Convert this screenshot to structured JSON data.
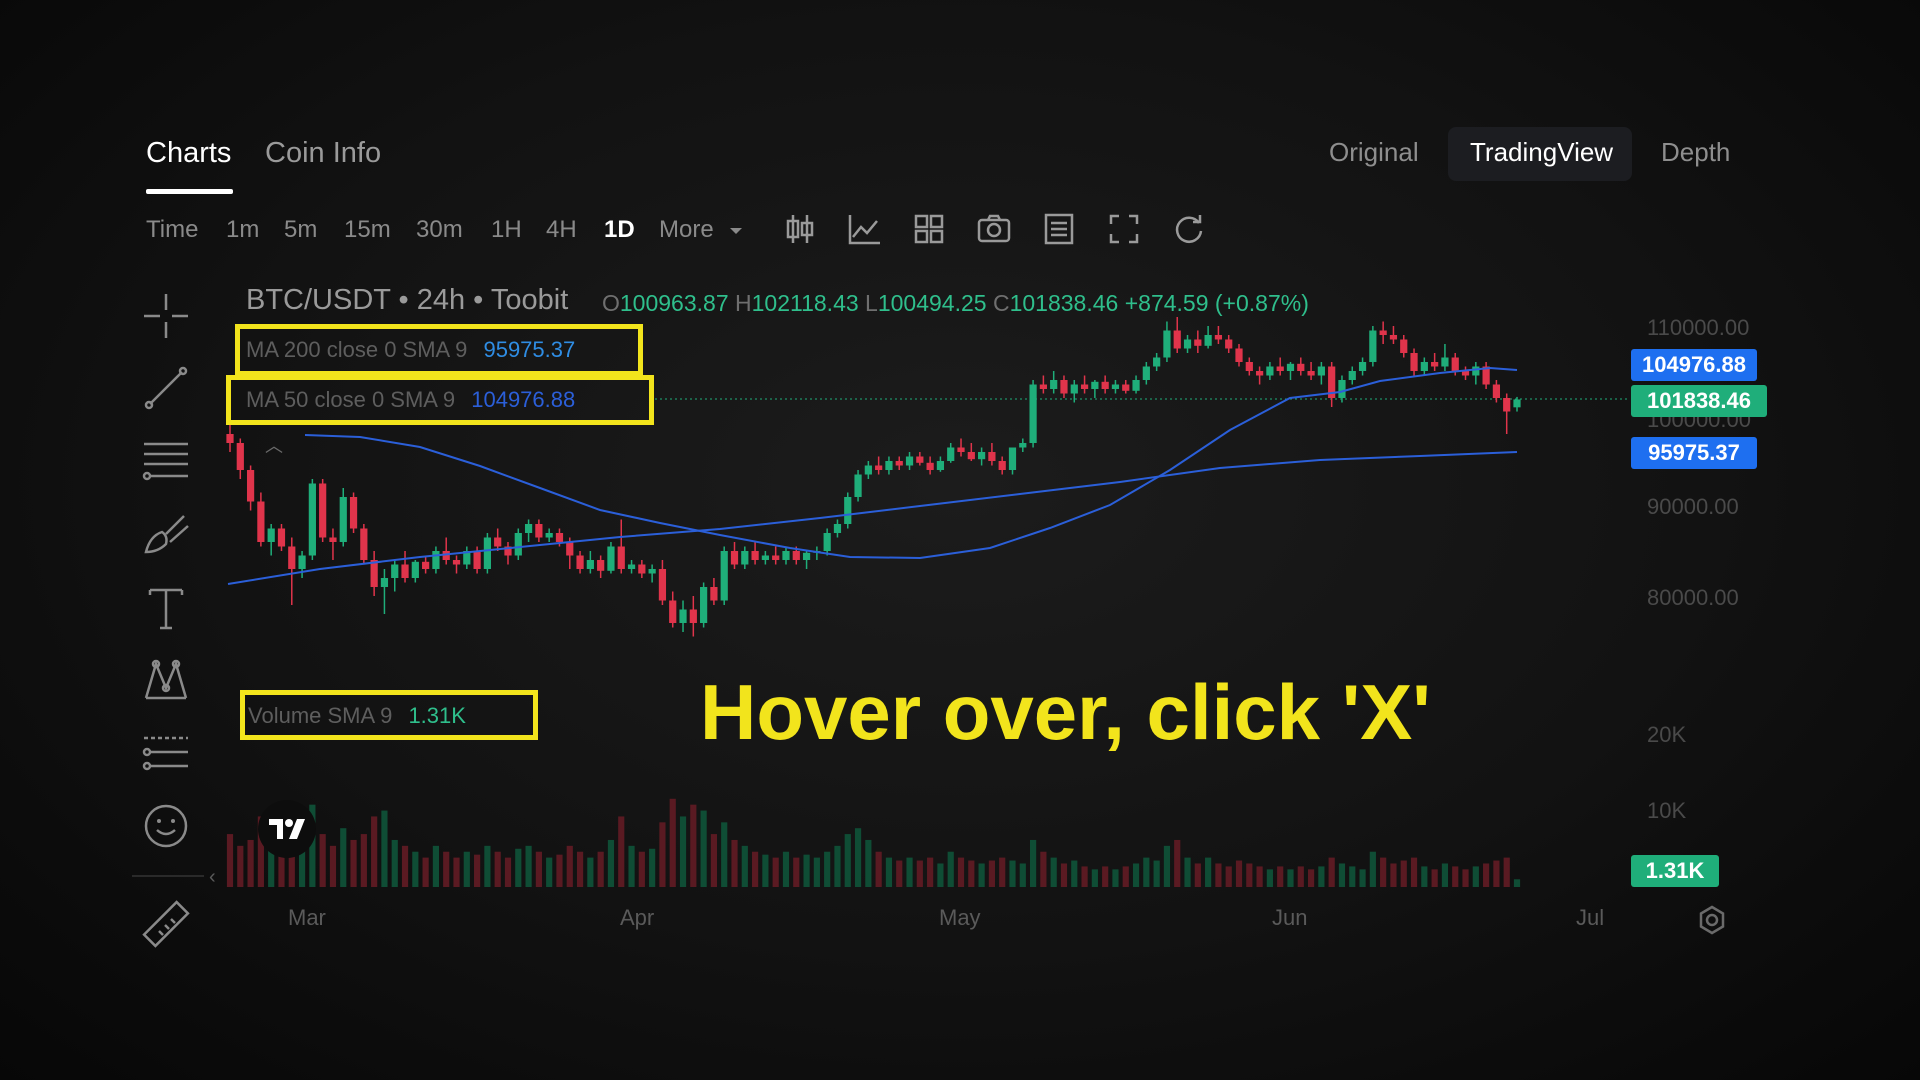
{
  "tabs": {
    "charts": "Charts",
    "coin_info": "Coin Info"
  },
  "views": {
    "original": "Original",
    "tradingview": "TradingView",
    "depth": "Depth",
    "selected": "TradingView"
  },
  "timeframes": [
    "Time",
    "1m",
    "5m",
    "15m",
    "30m",
    "1H",
    "4H",
    "1D",
    "More"
  ],
  "timeframe_selected": "1D",
  "toolbar_icons": [
    "candle-type-icon",
    "indicators-icon",
    "layout-grid-icon",
    "camera-icon",
    "list-icon",
    "fullscreen-icon",
    "reset-icon"
  ],
  "drawing_tools": [
    "crosshair-icon",
    "trendline-icon",
    "horizontal-lines-icon",
    "brush-icon",
    "text-icon",
    "pattern-icon",
    "measure-lines-icon",
    "emoji-icon",
    "ruler-icon"
  ],
  "chart_header": {
    "symbol": "BTC/USDT • 24h • Toobit",
    "o_label": "O",
    "o": "100963.87",
    "h_label": "H",
    "h": "102118.43",
    "l_label": "L",
    "l": "100494.25",
    "c_label": "C",
    "c": "101838.46",
    "change": "+874.59 (+0.87%)"
  },
  "legends": {
    "ma200_name": "MA 200 close 0 SMA 9",
    "ma200_value": "95975.37",
    "ma50_name": "MA 50 close 0 SMA 9",
    "ma50_value": "104976.88",
    "volume_name": "Volume SMA 9",
    "volume_value": "1.31K"
  },
  "price_tags": {
    "ma50": "104976.88",
    "last": "101838.46",
    "ma200": "95975.37",
    "volume": "1.31K"
  },
  "price_axis": [
    "110000.00",
    "100000.00",
    "90000.00",
    "80000.00"
  ],
  "volume_axis": [
    "20K",
    "10K"
  ],
  "months": [
    "Mar",
    "Apr",
    "May",
    "Jun",
    "Jul"
  ],
  "hint_text": "Hover over, click 'X'",
  "colors": {
    "up": "#1fae7a",
    "down": "#e0344b",
    "ma": "#2b5fd9",
    "highlight": "#f2e41c",
    "tag_blue": "#1e6ff0",
    "tag_green": "#1fae7a"
  },
  "chart_data": {
    "type": "candlestick",
    "x_range": [
      "Feb",
      "Jun"
    ],
    "ylim": [
      75000,
      111000
    ],
    "candles": [
      [
        98000,
        99500,
        96000,
        97000
      ],
      [
        97000,
        97500,
        93000,
        94000
      ],
      [
        94000,
        94500,
        89500,
        90500
      ],
      [
        90500,
        91500,
        85500,
        86000
      ],
      [
        86000,
        88000,
        84500,
        87500
      ],
      [
        87500,
        88000,
        85000,
        85500
      ],
      [
        85500,
        86500,
        79000,
        83000
      ],
      [
        83000,
        85000,
        82000,
        84500
      ],
      [
        84500,
        93000,
        84000,
        92500
      ],
      [
        92500,
        93000,
        86000,
        86500
      ],
      [
        86500,
        87500,
        84000,
        86000
      ],
      [
        86000,
        92000,
        85500,
        91000
      ],
      [
        91000,
        91500,
        87000,
        87500
      ],
      [
        87500,
        88000,
        83500,
        84000
      ],
      [
        84000,
        85000,
        80000,
        81000
      ],
      [
        81000,
        83000,
        78000,
        82000
      ],
      [
        82000,
        84000,
        80500,
        83500
      ],
      [
        83500,
        85000,
        81500,
        82000
      ],
      [
        82000,
        84000,
        81500,
        83800
      ],
      [
        83800,
        84500,
        82500,
        83000
      ],
      [
        83000,
        85500,
        82500,
        85000
      ],
      [
        85000,
        86500,
        83500,
        84000
      ],
      [
        84000,
        84500,
        82500,
        83500
      ],
      [
        83500,
        85500,
        83000,
        85000
      ],
      [
        85000,
        85500,
        82500,
        83000
      ],
      [
        83000,
        87000,
        82500,
        86500
      ],
      [
        86500,
        87500,
        85000,
        85500
      ],
      [
        85500,
        86000,
        83500,
        84500
      ],
      [
        84500,
        87500,
        84000,
        87000
      ],
      [
        87000,
        88500,
        86000,
        88000
      ],
      [
        88000,
        88500,
        86000,
        86500
      ],
      [
        86500,
        87500,
        86000,
        87000
      ],
      [
        87000,
        87500,
        85500,
        86000
      ],
      [
        86000,
        86500,
        83000,
        84500
      ],
      [
        84500,
        85000,
        82500,
        83000
      ],
      [
        83000,
        85000,
        82500,
        84000
      ],
      [
        84000,
        84500,
        82000,
        82800
      ],
      [
        82800,
        86000,
        82500,
        85500
      ],
      [
        85500,
        88500,
        82500,
        83000
      ],
      [
        83000,
        84000,
        82500,
        83500
      ],
      [
        83500,
        84000,
        82000,
        82500
      ],
      [
        82500,
        83500,
        81500,
        83000
      ],
      [
        83000,
        84000,
        79000,
        79500
      ],
      [
        79500,
        80500,
        76500,
        77000
      ],
      [
        77000,
        79500,
        76000,
        78500
      ],
      [
        78500,
        80000,
        75500,
        77000
      ],
      [
        77000,
        81500,
        76500,
        81000
      ],
      [
        81000,
        82000,
        79000,
        79500
      ],
      [
        79500,
        85500,
        79000,
        85000
      ],
      [
        85000,
        86000,
        83000,
        83500
      ],
      [
        83500,
        85500,
        83000,
        85000
      ],
      [
        85000,
        86000,
        83500,
        84000
      ],
      [
        84000,
        85000,
        83500,
        84500
      ],
      [
        84500,
        85500,
        83500,
        84000
      ],
      [
        84000,
        85500,
        83500,
        85000
      ],
      [
        85000,
        85500,
        83500,
        84000
      ],
      [
        84000,
        85000,
        83000,
        84800
      ],
      [
        84800,
        85500,
        84000,
        85000
      ],
      [
        85000,
        87500,
        84500,
        87000
      ],
      [
        87000,
        88500,
        86500,
        88000
      ],
      [
        88000,
        91500,
        87500,
        91000
      ],
      [
        91000,
        94000,
        90500,
        93500
      ],
      [
        93500,
        95000,
        93000,
        94500
      ],
      [
        94500,
        95500,
        93500,
        94000
      ],
      [
        94000,
        95500,
        93500,
        95000
      ],
      [
        95000,
        95500,
        94000,
        94500
      ],
      [
        94500,
        96000,
        94000,
        95500
      ],
      [
        95500,
        96000,
        94500,
        94800
      ],
      [
        94800,
        95500,
        93500,
        94000
      ],
      [
        94000,
        95500,
        93800,
        95000
      ],
      [
        95000,
        97000,
        94800,
        96500
      ],
      [
        96500,
        97500,
        95500,
        96000
      ],
      [
        96000,
        97000,
        95000,
        95200
      ],
      [
        95200,
        96500,
        94500,
        96000
      ],
      [
        96000,
        97000,
        94500,
        95000
      ],
      [
        95000,
        95500,
        93500,
        94000
      ],
      [
        94000,
        96500,
        93500,
        96500
      ],
      [
        96500,
        97500,
        96000,
        97000
      ],
      [
        97000,
        104000,
        96500,
        103500
      ],
      [
        103500,
        104500,
        102500,
        103000
      ],
      [
        103000,
        105000,
        102500,
        104000
      ],
      [
        104000,
        104500,
        102000,
        102500
      ],
      [
        102500,
        104000,
        101500,
        103500
      ],
      [
        103500,
        104500,
        102500,
        103000
      ],
      [
        103000,
        104000,
        102000,
        103800
      ],
      [
        103800,
        104500,
        102500,
        103000
      ],
      [
        103000,
        104000,
        102500,
        103500
      ],
      [
        103500,
        104000,
        102500,
        102800
      ],
      [
        102800,
        104500,
        102500,
        104000
      ],
      [
        104000,
        106000,
        103500,
        105500
      ],
      [
        105500,
        107000,
        105000,
        106500
      ],
      [
        106500,
        110500,
        106000,
        109500
      ],
      [
        109500,
        111000,
        107000,
        107500
      ],
      [
        107500,
        109000,
        107000,
        108500
      ],
      [
        108500,
        109500,
        107000,
        107800
      ],
      [
        107800,
        110000,
        107500,
        109000
      ],
      [
        109000,
        110000,
        108000,
        108500
      ],
      [
        108500,
        109000,
        107000,
        107500
      ],
      [
        107500,
        108000,
        105500,
        106000
      ],
      [
        106000,
        106500,
        104500,
        105000
      ],
      [
        105000,
        105500,
        103500,
        104500
      ],
      [
        104500,
        106000,
        104000,
        105500
      ],
      [
        105500,
        106500,
        104500,
        105000
      ],
      [
        105000,
        106000,
        104000,
        105800
      ],
      [
        105800,
        106500,
        104500,
        105000
      ],
      [
        105000,
        106000,
        104000,
        104500
      ],
      [
        104500,
        106000,
        103500,
        105500
      ],
      [
        105500,
        106000,
        101000,
        102000
      ],
      [
        102000,
        104500,
        101500,
        104000
      ],
      [
        104000,
        105500,
        103500,
        105000
      ],
      [
        105000,
        106500,
        104500,
        106000
      ],
      [
        106000,
        110000,
        105500,
        109500
      ],
      [
        109500,
        110500,
        108000,
        109000
      ],
      [
        109000,
        110000,
        108000,
        108500
      ],
      [
        108500,
        109000,
        106500,
        107000
      ],
      [
        107000,
        107500,
        104500,
        105000
      ],
      [
        105000,
        106500,
        104500,
        106000
      ],
      [
        106000,
        107000,
        105000,
        105500
      ],
      [
        105500,
        108000,
        105000,
        106500
      ],
      [
        106500,
        107000,
        104500,
        105000
      ],
      [
        105000,
        105500,
        104000,
        104500
      ],
      [
        104500,
        106000,
        103500,
        105500
      ],
      [
        105500,
        106000,
        103000,
        103500
      ],
      [
        103500,
        104000,
        101500,
        102000
      ],
      [
        102000,
        102500,
        98000,
        100500
      ],
      [
        100963.87,
        102118.43,
        100494.25,
        101838.46
      ]
    ],
    "volume_max": 25000,
    "volumes": [
      9000,
      7000,
      8000,
      12000,
      9000,
      6000,
      11000,
      8000,
      14000,
      9000,
      7000,
      10000,
      8000,
      9000,
      12000,
      13000,
      8000,
      7000,
      6000,
      5000,
      7000,
      6000,
      5000,
      6000,
      5500,
      7000,
      6000,
      5000,
      6500,
      7000,
      6000,
      5000,
      5500,
      7000,
      6000,
      5000,
      6000,
      8000,
      12000,
      7000,
      6000,
      6500,
      11000,
      15000,
      12000,
      14000,
      13000,
      9000,
      11000,
      8000,
      7000,
      6000,
      5500,
      5000,
      6000,
      5000,
      5500,
      5000,
      6000,
      7000,
      9000,
      10000,
      8000,
      6000,
      5000,
      4500,
      5000,
      4500,
      5000,
      4000,
      6000,
      5000,
      4500,
      4000,
      4500,
      5000,
      4500,
      4000,
      8000,
      6000,
      5000,
      4000,
      4500,
      3500,
      3000,
      3500,
      3000,
      3500,
      4000,
      5000,
      4500,
      7000,
      8000,
      5000,
      4000,
      5000,
      4000,
      3500,
      4500,
      4000,
      3500,
      3000,
      3500,
      3000,
      3500,
      3000,
      3500,
      5000,
      4000,
      3500,
      3000,
      6000,
      5000,
      4000,
      4500,
      5000,
      3500,
      3000,
      4000,
      3500,
      3000,
      3500,
      4000,
      4500,
      5000,
      1310
    ]
  }
}
